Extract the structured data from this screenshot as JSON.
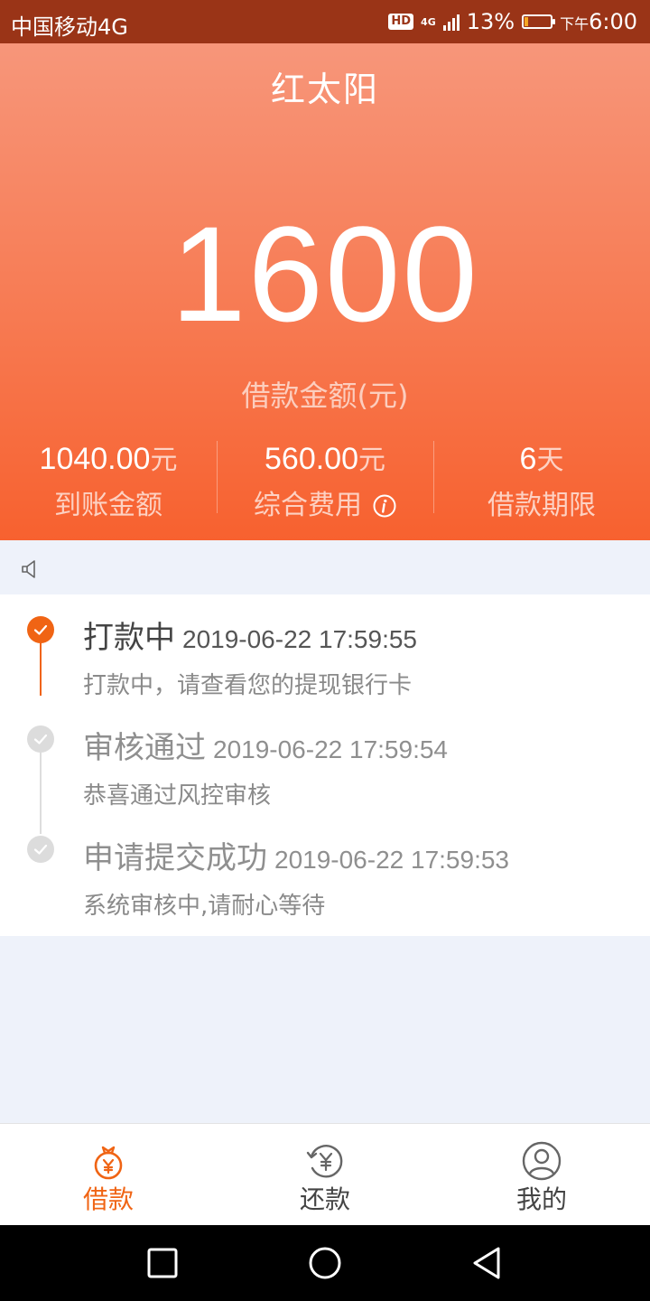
{
  "status_bar": {
    "carrier": "中国移动4G",
    "hd_badge": "HD",
    "network": "4G",
    "battery_percent": "13%",
    "battery_level": 0.13,
    "time_prefix": "下午",
    "time": "6:00"
  },
  "header": {
    "app_title": "红太阳",
    "amount": "1600",
    "amount_label": "借款金额(元)",
    "stats": [
      {
        "value": "1040.00",
        "unit": "元",
        "label": "到账金额"
      },
      {
        "value": "560.00",
        "unit": "元",
        "label": "综合费用"
      },
      {
        "value": "6",
        "unit": "天",
        "label": "借款期限"
      }
    ]
  },
  "timeline": [
    {
      "title": "打款中",
      "time": "2019-06-22 17:59:55",
      "desc": "打款中，请查看您的提现银行卡",
      "state": "active"
    },
    {
      "title": "审核通过",
      "time": "2019-06-22 17:59:54",
      "desc": "恭喜通过风控审核",
      "state": "done"
    },
    {
      "title": "申请提交成功",
      "time": "2019-06-22 17:59:53",
      "desc": "系统审核中,请耐心等待",
      "state": "done"
    }
  ],
  "bottom_nav": [
    {
      "label": "借款",
      "icon": "money-bag-icon",
      "active": true
    },
    {
      "label": "还款",
      "icon": "repay-icon",
      "active": false
    },
    {
      "label": "我的",
      "icon": "user-icon",
      "active": false
    }
  ],
  "colors": {
    "accent": "#f06414",
    "header_top": "#f7967a",
    "header_bottom": "#f7612f",
    "status_bar": "#9a3417",
    "background": "#eef2fa"
  }
}
